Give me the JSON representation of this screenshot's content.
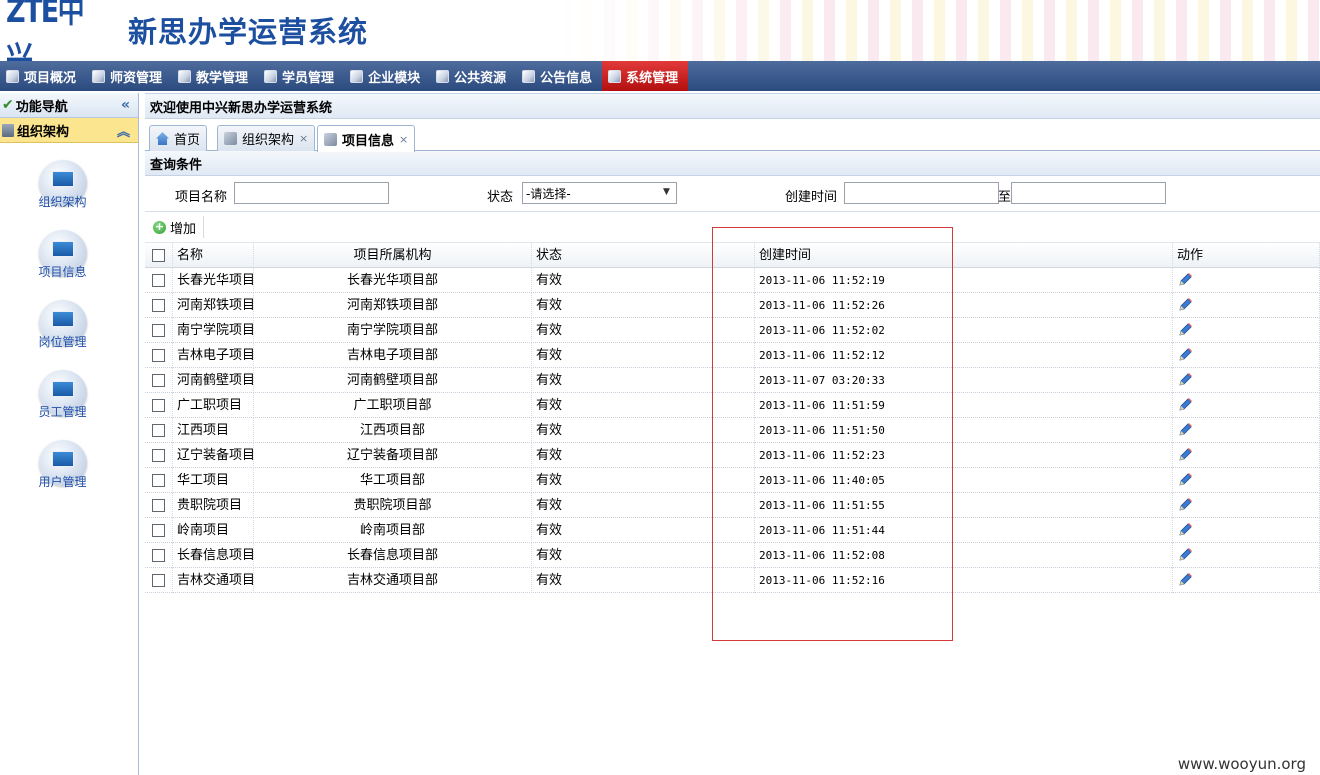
{
  "header": {
    "brand": "ZTE中兴",
    "system_title": "新思办学运营系统"
  },
  "topnav": {
    "items": [
      {
        "label": "项目概况",
        "icon": "project-overview-icon",
        "active": false
      },
      {
        "label": "师资管理",
        "icon": "teacher-icon",
        "active": false
      },
      {
        "label": "教学管理",
        "icon": "teaching-icon",
        "active": false
      },
      {
        "label": "学员管理",
        "icon": "students-icon",
        "active": false
      },
      {
        "label": "企业模块",
        "icon": "enterprise-icon",
        "active": false
      },
      {
        "label": "公共资源",
        "icon": "resource-icon",
        "active": false
      },
      {
        "label": "公告信息",
        "icon": "notice-icon",
        "active": false
      },
      {
        "label": "系统管理",
        "icon": "monitor-icon",
        "active": true
      }
    ]
  },
  "sidebar": {
    "title": "功能导航",
    "collapse_glyph": "«",
    "group_title": "组织架构",
    "group_toggle_glyph": "︽",
    "tools": [
      "组织架构",
      "项目信息",
      "岗位管理",
      "员工管理",
      "用户管理"
    ]
  },
  "main": {
    "welcome": "欢迎使用中兴新思办学运营系统",
    "tabs": [
      {
        "label": "首页",
        "icon": "home-icon",
        "closable": false,
        "active": false
      },
      {
        "label": "组织架构",
        "icon": "org-icon",
        "closable": true,
        "active": false
      },
      {
        "label": "项目信息",
        "icon": "project-icon",
        "closable": true,
        "active": true
      }
    ],
    "close_glyph": "×",
    "query": {
      "title": "查询条件",
      "name_label": "项目名称",
      "name_value": "",
      "status_label": "状态",
      "status_value": "-请选择-",
      "created_label": "创建时间",
      "range_sep": "至",
      "created_from": "",
      "created_to": ""
    },
    "toolbar": {
      "add_label": "增加"
    },
    "grid": {
      "columns": [
        "名称",
        "项目所属机构",
        "状态",
        "创建时间",
        "动作"
      ],
      "rows": [
        {
          "name": "长春光华项目",
          "org": "长春光华项目部",
          "status": "有效",
          "created": "2013-11-06 11:52:19"
        },
        {
          "name": "河南郑铁项目",
          "org": "河南郑铁项目部",
          "status": "有效",
          "created": "2013-11-06 11:52:26"
        },
        {
          "name": "南宁学院项目",
          "org": "南宁学院项目部",
          "status": "有效",
          "created": "2013-11-06 11:52:02"
        },
        {
          "name": "吉林电子项目",
          "org": "吉林电子项目部",
          "status": "有效",
          "created": "2013-11-06 11:52:12"
        },
        {
          "name": "河南鹤壁项目",
          "org": "河南鹤壁项目部",
          "status": "有效",
          "created": "2013-11-07 03:20:33"
        },
        {
          "name": "广工职项目",
          "org": "广工职项目部",
          "status": "有效",
          "created": "2013-11-06 11:51:59"
        },
        {
          "name": "江西项目",
          "org": "江西项目部",
          "status": "有效",
          "created": "2013-11-06 11:51:50"
        },
        {
          "name": "辽宁装备项目",
          "org": "辽宁装备项目部",
          "status": "有效",
          "created": "2013-11-06 11:52:23"
        },
        {
          "name": "华工项目",
          "org": "华工项目部",
          "status": "有效",
          "created": "2013-11-06 11:40:05"
        },
        {
          "name": "贵职院项目",
          "org": "贵职院项目部",
          "status": "有效",
          "created": "2013-11-06 11:51:55"
        },
        {
          "name": "岭南项目",
          "org": "岭南项目部",
          "status": "有效",
          "created": "2013-11-06 11:51:44"
        },
        {
          "name": "长春信息项目",
          "org": "长春信息项目部",
          "status": "有效",
          "created": "2013-11-06 11:52:08"
        },
        {
          "name": "吉林交通项目",
          "org": "吉林交通项目部",
          "status": "有效",
          "created": "2013-11-06 11:52:16"
        }
      ]
    }
  },
  "watermark": "www.wooyun.org",
  "colors": {
    "nav_bg": "#2b4a7f",
    "nav_active": "#c41a1a",
    "brand_blue": "#1d4fa0",
    "group_highlight": "#fbe58f",
    "annotation_red": "#d43a3a"
  }
}
